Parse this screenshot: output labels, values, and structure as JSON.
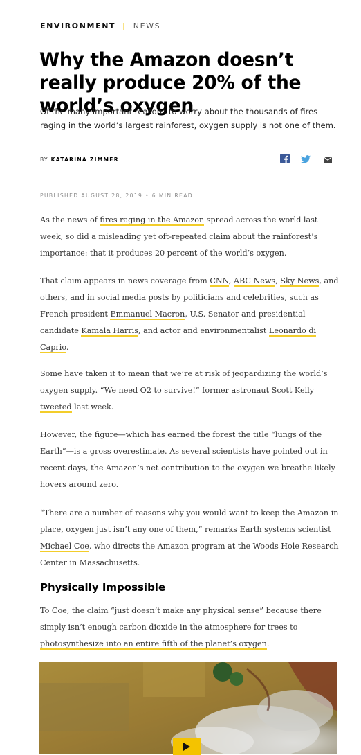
{
  "article": {
    "category": "ENVIRONMENT",
    "separator": "|",
    "type": "NEWS",
    "title": "Why the Amazon doesn’t really produce 20% of the world’s oxygen",
    "dek": "Of the many important reasons to worry about the thousands of fires raging in the world’s largest rainforest, oxygen supply is not one of them.",
    "byline_prefix": "BY",
    "author": "KATARINA ZIMMER",
    "published": "PUBLISHED AUGUST 28, 2019 • 6 MIN READ"
  },
  "share": {
    "facebook_icon": "facebook-icon",
    "twitter_icon": "twitter-icon",
    "email_icon": "email-icon"
  },
  "body": {
    "p1": {
      "t1": "As the news of ",
      "l1": "fires raging in the Amazon",
      "t2": " spread across the world last week, so did a misleading yet oft-repeated claim about the rainforest’s importance: that it produces 20 percent of the world’s oxygen."
    },
    "p2": {
      "t1": "That claim appears in news coverage from ",
      "l1": "CNN",
      "t2": ", ",
      "l2": "ABC News",
      "t3": ", ",
      "l3": "Sky News",
      "t4": ", and others, and in social media posts by politicians and celebrities, such as French president ",
      "l4": "Emmanuel Macron",
      "t5": ", U.S. Senator and presidential candidate ",
      "l5": "Kamala Harris",
      "t6": ", and actor and environmentalist ",
      "l6": "Leonardo di Caprio",
      "t7": "."
    },
    "p3": {
      "t1": "Some have taken it to mean that we’re at risk of jeopardizing the world’s oxygen supply. “We need O2 to survive!” former astronaut Scott Kelly ",
      "l1": "tweeted",
      "t2": " last week."
    },
    "p4": {
      "t1": "However, the figure—which has earned the forest the title “lungs of the Earth”—is a gross overestimate. As several scientists have pointed out in recent days, the Amazon’s net contribution to the oxygen we breathe likely hovers around zero."
    },
    "p5": {
      "t1": "“There are a number of reasons why you would want to keep the Amazon in place, oxygen just isn’t any one of them,” remarks Earth systems scientist ",
      "l1": "Michael Coe",
      "t2": ", who directs the Amazon program at the Woods Hole Research Center in Massachusetts."
    },
    "subhead": "Physically Impossible",
    "p6": {
      "t1": "To Coe, the claim “just doesn’t make any physical sense” because there simply isn’t enough carbon dioxide in the atmosphere for trees to ",
      "l1": "photosynthesize into an entire fifth of the planet’s oxygen",
      "t2": "."
    }
  },
  "media": {
    "play_icon": "play-icon"
  },
  "colors": {
    "accent": "#f3cd2a",
    "text": "#333333"
  }
}
